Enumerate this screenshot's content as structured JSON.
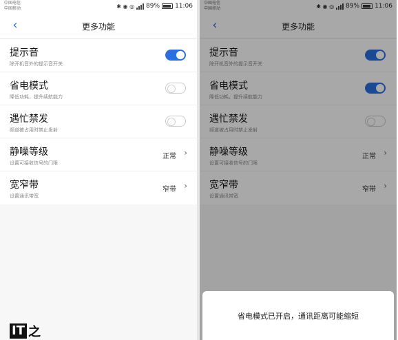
{
  "status": {
    "carrier_line1": "中国电信",
    "carrier_line2": "中国移动",
    "icons_left": "✱ ◉ ◎",
    "battery_pct": "89%",
    "time": "11:06"
  },
  "header": {
    "back_icon": "‹",
    "title": "更多功能"
  },
  "rows": [
    {
      "title": "提示音",
      "subtitle": "除开机音外的提示音开关"
    },
    {
      "title": "省电模式",
      "subtitle": "降低功耗，提升续航能力"
    },
    {
      "title": "遇忙禁发",
      "subtitle": "频道被占用时禁止发射"
    },
    {
      "title": "静噪等级",
      "subtitle": "设置可接收信号的门限",
      "value": "正常"
    },
    {
      "title": "宽窄带",
      "subtitle": "设置通讯带宽",
      "value": "窄带"
    }
  ],
  "left_toggles": {
    "beep": true,
    "power_save": false,
    "busy_lockout": false
  },
  "right_toggles": {
    "beep": true,
    "power_save": true,
    "busy_lockout": false
  },
  "chevron_icon": "›",
  "dialog": {
    "message": "省电模式已开启，通讯距离可能缩短"
  },
  "watermark": {
    "logo_text": "IT",
    "logo_char": "之"
  },
  "colors": {
    "accent": "#2a6fe0",
    "dim_overlay": "rgba(0,0,0,0.34)"
  }
}
